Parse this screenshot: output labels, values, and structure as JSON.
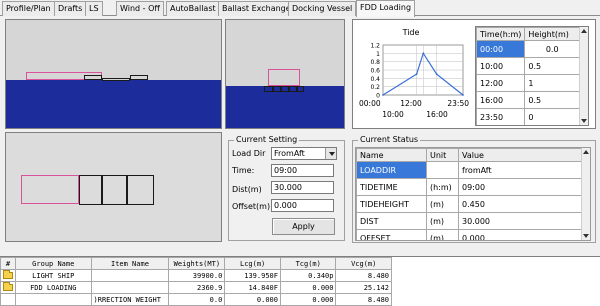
{
  "tabs": [
    {
      "label": "Profile/Plan",
      "active": false
    },
    {
      "label": "Drafts",
      "active": false
    },
    {
      "label": "LS",
      "active": false
    },
    {
      "label": "Wind - Off",
      "active": false
    },
    {
      "label": "AutoBallast",
      "active": false
    },
    {
      "label": "Ballast Exchange",
      "active": false
    },
    {
      "label": "Docking Vessel",
      "active": false
    },
    {
      "label": "FDD Loading",
      "active": true
    }
  ],
  "tide_chart": {
    "title": "Tide",
    "y_ticks": [
      "1.2",
      "1",
      "0.8",
      "0.6",
      "0.4",
      "0.2",
      "0"
    ],
    "x_ticks_top": [
      "00:00",
      "12:00",
      "23:50"
    ],
    "x_ticks_bottom": [
      "10:00",
      "16:00"
    ]
  },
  "chart_data": {
    "type": "line",
    "title": "Tide",
    "x": [
      "00:00",
      "10:00",
      "12:00",
      "16:00",
      "23:50"
    ],
    "series": [
      {
        "values": [
          0.0,
          0.5,
          1.0,
          0.5,
          0.0
        ]
      }
    ],
    "ylim": [
      0,
      1.2
    ]
  },
  "tide_table": {
    "headers": [
      "Time(h:m)",
      "Height(m)"
    ],
    "rows": [
      [
        "00:00",
        "0.0"
      ],
      [
        "10:00",
        "0.5"
      ],
      [
        "12:00",
        "1"
      ],
      [
        "16:00",
        "0.5"
      ],
      [
        "23:50",
        "0"
      ]
    ]
  },
  "current_setting": {
    "title": "Current Setting",
    "load_dir_label": "Load Dir",
    "load_dir_value": "FromAft",
    "time_label": "Time:",
    "time_value": "09:00",
    "dist_label": "Dist(m)",
    "dist_value": "30.000",
    "offset_label": "Offset(m)",
    "offset_value": "0.000",
    "apply_label": "Apply"
  },
  "current_status": {
    "title": "Current Status",
    "headers": [
      "Name",
      "Unit",
      "Value"
    ],
    "rows": [
      [
        "LOADDIR",
        "",
        "fromAft"
      ],
      [
        "TIDETIME",
        "(h:m)",
        "09:00"
      ],
      [
        "TIDEHEIGHT",
        "(m)",
        "0.450"
      ],
      [
        "DIST",
        "(m)",
        "30.000"
      ],
      [
        "OFFSET",
        "(m)",
        "0.000"
      ]
    ]
  },
  "weights_table": {
    "headers": [
      "#",
      "Group Name",
      "Item Name",
      "Weights(MT)",
      "Lcg(m)",
      "Tcg(m)",
      "Vcg(m)"
    ],
    "rows": [
      {
        "icon": "folder",
        "group": "LIGHT SHIP",
        "item": "",
        "weight": "39900.0",
        "lcg": "139.950F",
        "tcg": "0.340p",
        "vcg": "8.480"
      },
      {
        "icon": "folder",
        "group": "FDD LOADING",
        "item": "",
        "weight": "2360.9",
        "lcg": "14.840F",
        "tcg": "0.000",
        "vcg": "25.142"
      },
      {
        "icon": "",
        "group": "",
        "item": ")RRECTION WEIGHT",
        "weight": "0.0",
        "lcg": "0.000",
        "tcg": "0.000",
        "vcg": "8.480"
      }
    ]
  }
}
